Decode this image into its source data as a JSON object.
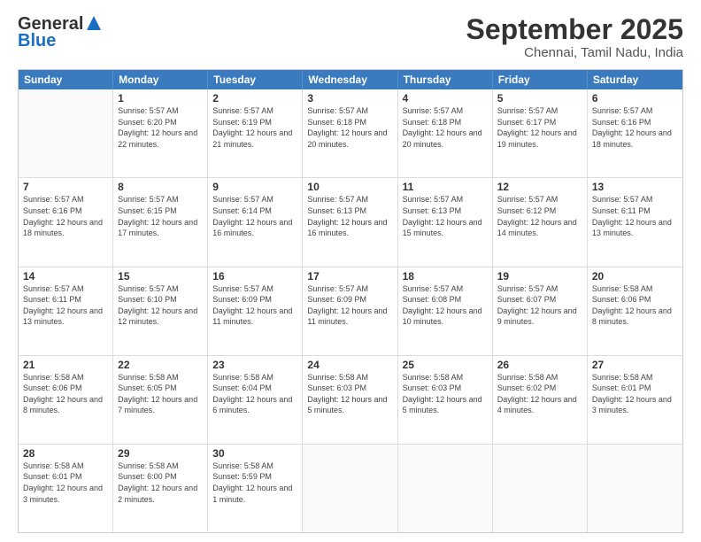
{
  "logo": {
    "line1": "General",
    "line2": "Blue"
  },
  "title": "September 2025",
  "subtitle": "Chennai, Tamil Nadu, India",
  "days_of_week": [
    "Sunday",
    "Monday",
    "Tuesday",
    "Wednesday",
    "Thursday",
    "Friday",
    "Saturday"
  ],
  "weeks": [
    [
      {
        "day": "",
        "empty": true
      },
      {
        "day": "1",
        "sunrise": "5:57 AM",
        "sunset": "6:20 PM",
        "daylight": "12 hours and 22 minutes."
      },
      {
        "day": "2",
        "sunrise": "5:57 AM",
        "sunset": "6:19 PM",
        "daylight": "12 hours and 21 minutes."
      },
      {
        "day": "3",
        "sunrise": "5:57 AM",
        "sunset": "6:18 PM",
        "daylight": "12 hours and 20 minutes."
      },
      {
        "day": "4",
        "sunrise": "5:57 AM",
        "sunset": "6:18 PM",
        "daylight": "12 hours and 20 minutes."
      },
      {
        "day": "5",
        "sunrise": "5:57 AM",
        "sunset": "6:17 PM",
        "daylight": "12 hours and 19 minutes."
      },
      {
        "day": "6",
        "sunrise": "5:57 AM",
        "sunset": "6:16 PM",
        "daylight": "12 hours and 18 minutes."
      }
    ],
    [
      {
        "day": "7",
        "sunrise": "5:57 AM",
        "sunset": "6:16 PM",
        "daylight": "12 hours and 18 minutes."
      },
      {
        "day": "8",
        "sunrise": "5:57 AM",
        "sunset": "6:15 PM",
        "daylight": "12 hours and 17 minutes."
      },
      {
        "day": "9",
        "sunrise": "5:57 AM",
        "sunset": "6:14 PM",
        "daylight": "12 hours and 16 minutes."
      },
      {
        "day": "10",
        "sunrise": "5:57 AM",
        "sunset": "6:13 PM",
        "daylight": "12 hours and 16 minutes."
      },
      {
        "day": "11",
        "sunrise": "5:57 AM",
        "sunset": "6:13 PM",
        "daylight": "12 hours and 15 minutes."
      },
      {
        "day": "12",
        "sunrise": "5:57 AM",
        "sunset": "6:12 PM",
        "daylight": "12 hours and 14 minutes."
      },
      {
        "day": "13",
        "sunrise": "5:57 AM",
        "sunset": "6:11 PM",
        "daylight": "12 hours and 13 minutes."
      }
    ],
    [
      {
        "day": "14",
        "sunrise": "5:57 AM",
        "sunset": "6:11 PM",
        "daylight": "12 hours and 13 minutes."
      },
      {
        "day": "15",
        "sunrise": "5:57 AM",
        "sunset": "6:10 PM",
        "daylight": "12 hours and 12 minutes."
      },
      {
        "day": "16",
        "sunrise": "5:57 AM",
        "sunset": "6:09 PM",
        "daylight": "12 hours and 11 minutes."
      },
      {
        "day": "17",
        "sunrise": "5:57 AM",
        "sunset": "6:09 PM",
        "daylight": "12 hours and 11 minutes."
      },
      {
        "day": "18",
        "sunrise": "5:57 AM",
        "sunset": "6:08 PM",
        "daylight": "12 hours and 10 minutes."
      },
      {
        "day": "19",
        "sunrise": "5:57 AM",
        "sunset": "6:07 PM",
        "daylight": "12 hours and 9 minutes."
      },
      {
        "day": "20",
        "sunrise": "5:58 AM",
        "sunset": "6:06 PM",
        "daylight": "12 hours and 8 minutes."
      }
    ],
    [
      {
        "day": "21",
        "sunrise": "5:58 AM",
        "sunset": "6:06 PM",
        "daylight": "12 hours and 8 minutes."
      },
      {
        "day": "22",
        "sunrise": "5:58 AM",
        "sunset": "6:05 PM",
        "daylight": "12 hours and 7 minutes."
      },
      {
        "day": "23",
        "sunrise": "5:58 AM",
        "sunset": "6:04 PM",
        "daylight": "12 hours and 6 minutes."
      },
      {
        "day": "24",
        "sunrise": "5:58 AM",
        "sunset": "6:03 PM",
        "daylight": "12 hours and 5 minutes."
      },
      {
        "day": "25",
        "sunrise": "5:58 AM",
        "sunset": "6:03 PM",
        "daylight": "12 hours and 5 minutes."
      },
      {
        "day": "26",
        "sunrise": "5:58 AM",
        "sunset": "6:02 PM",
        "daylight": "12 hours and 4 minutes."
      },
      {
        "day": "27",
        "sunrise": "5:58 AM",
        "sunset": "6:01 PM",
        "daylight": "12 hours and 3 minutes."
      }
    ],
    [
      {
        "day": "28",
        "sunrise": "5:58 AM",
        "sunset": "6:01 PM",
        "daylight": "12 hours and 3 minutes."
      },
      {
        "day": "29",
        "sunrise": "5:58 AM",
        "sunset": "6:00 PM",
        "daylight": "12 hours and 2 minutes."
      },
      {
        "day": "30",
        "sunrise": "5:58 AM",
        "sunset": "5:59 PM",
        "daylight": "12 hours and 1 minute."
      },
      {
        "day": "",
        "empty": true
      },
      {
        "day": "",
        "empty": true
      },
      {
        "day": "",
        "empty": true
      },
      {
        "day": "",
        "empty": true
      }
    ]
  ]
}
